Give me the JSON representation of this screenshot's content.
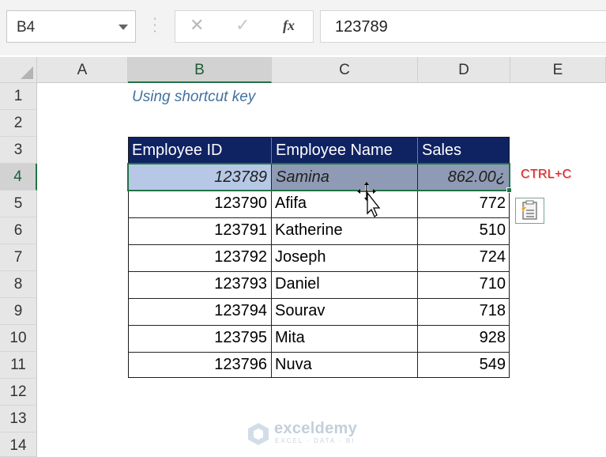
{
  "formula_bar": {
    "name_box": "B4",
    "cancel_icon": "close-icon",
    "enter_icon": "checkmark-icon",
    "function_label": "fx",
    "formula_value": "123789"
  },
  "columns": [
    "A",
    "B",
    "C",
    "D",
    "E"
  ],
  "rows": [
    "1",
    "2",
    "3",
    "4",
    "5",
    "6",
    "7",
    "8",
    "9",
    "10",
    "11",
    "12",
    "13",
    "14"
  ],
  "selected_cell": {
    "column": "B",
    "row": "4"
  },
  "sheet": {
    "title": "Using shortcut key",
    "headers": [
      "Employee ID",
      "Employee Name",
      "Sales"
    ],
    "records": [
      {
        "id": "123789",
        "name": "Samina",
        "sales": "862.00¿"
      },
      {
        "id": "123790",
        "name": "Afifa",
        "sales": "772"
      },
      {
        "id": "123791",
        "name": "Katherine",
        "sales": "510"
      },
      {
        "id": "123792",
        "name": "Joseph",
        "sales": "724"
      },
      {
        "id": "123793",
        "name": "Daniel",
        "sales": "710"
      },
      {
        "id": "123794",
        "name": "Sourav",
        "sales": "718"
      },
      {
        "id": "123795",
        "name": "Mita",
        "sales": "928"
      },
      {
        "id": "123796",
        "name": "Nuva",
        "sales": "549"
      }
    ]
  },
  "annotation": "CTRL+C",
  "paste_options_icon": "paste-options-icon",
  "watermark": {
    "name": "exceldemy",
    "tagline": "EXCEL · DATA · BI"
  },
  "colors": {
    "header_fill": "#0f2262",
    "selection_border": "#217346",
    "selected_id_fill": "#b6c8e6",
    "selected_row_fill": "#8f9bb5",
    "annotation": "#d81e1e",
    "title": "#41729f"
  }
}
